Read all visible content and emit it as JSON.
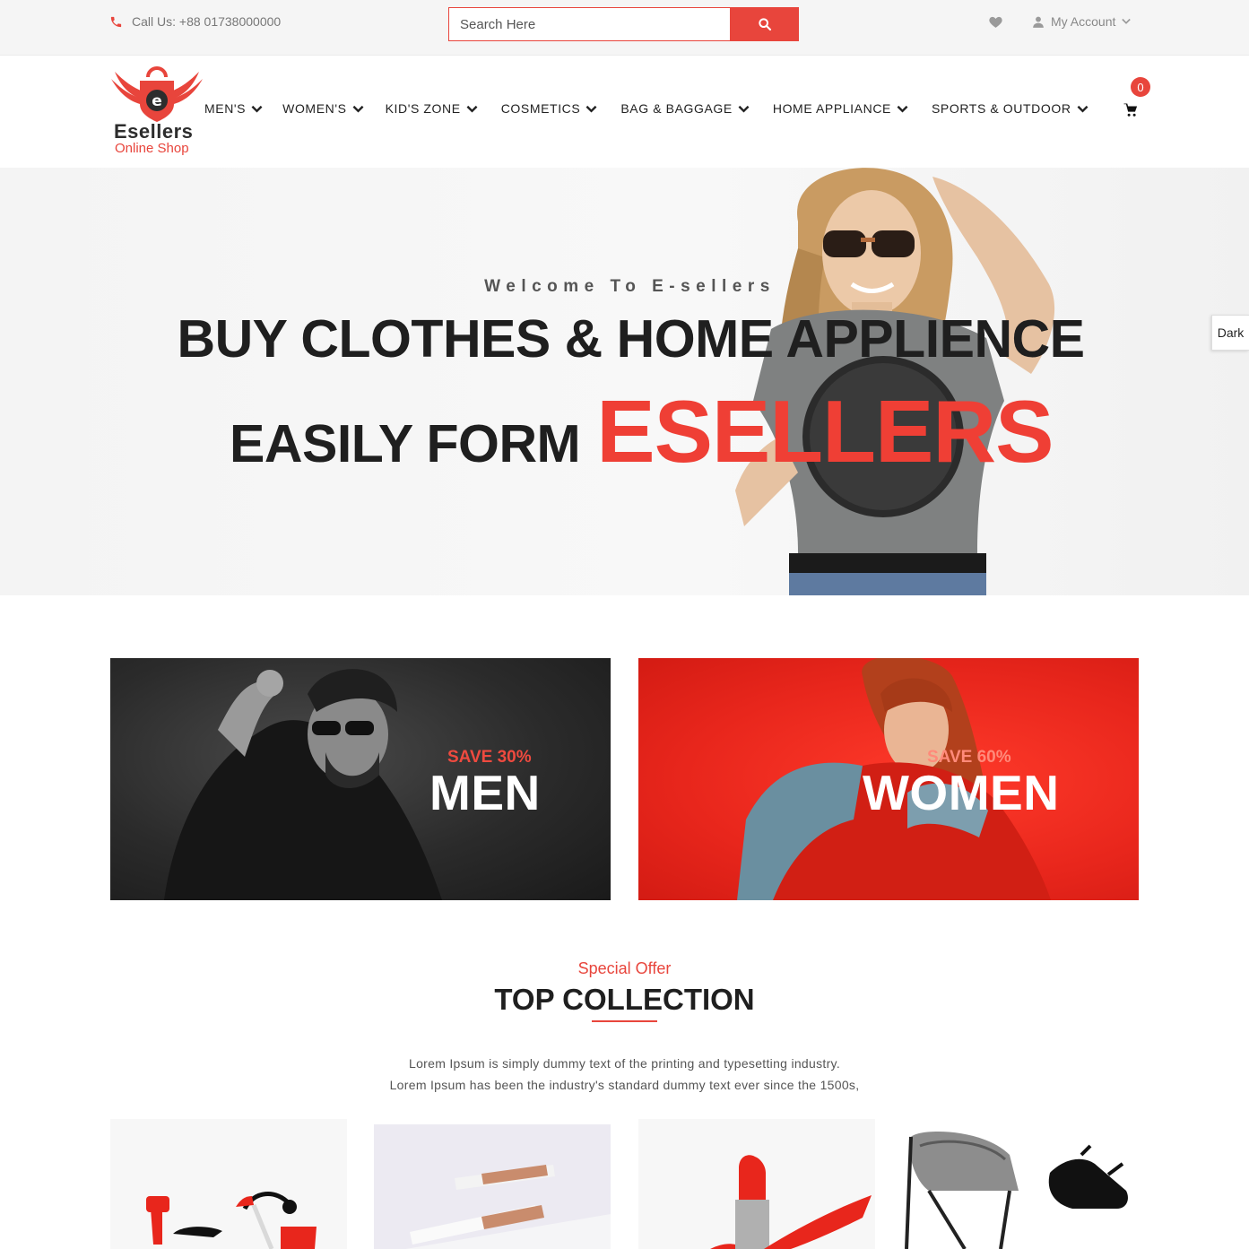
{
  "topbar": {
    "call_text": "Call Us: +88 01738000000",
    "search_placeholder": "Search Here",
    "account_label": "My Account"
  },
  "brand": {
    "name": "Esellers",
    "tagline": "Online Shop"
  },
  "nav": {
    "items": [
      {
        "label": "MEN'S"
      },
      {
        "label": "WOMEN'S"
      },
      {
        "label": "KID'S ZONE"
      },
      {
        "label": "COSMETICS"
      },
      {
        "label": "BAG & BAGGAGE"
      },
      {
        "label": "HOME APPLIANCE"
      },
      {
        "label": "SPORTS & OUTDOOR"
      }
    ],
    "cart_count": "0"
  },
  "hero": {
    "welcome": "Welcome To E-sellers",
    "line1": "BUY CLOTHES & HOME APPLIENCE",
    "line2_lead": "EASILY FORM",
    "line2_brand": "ESELLERS"
  },
  "theme_toggle": "Dark",
  "banners": {
    "men": {
      "save": "SAVE 30%",
      "title": "MEN"
    },
    "women": {
      "save": "SAVE 60%",
      "title": "WOMEN"
    }
  },
  "collection": {
    "eyebrow": "Special Offer",
    "title": "TOP COLLECTION",
    "desc_line1": "Lorem Ipsum is simply dummy text of the printing and typesetting industry.",
    "desc_line2": "Lorem Ipsum has been the industry's standard dummy text ever since the 1500s,"
  },
  "colors": {
    "accent": "#e8453c",
    "topbar_bg": "#f5f5f5",
    "text_dark": "#1f1f1f"
  },
  "icons": [
    "phone-icon",
    "search-icon",
    "heart-icon",
    "user-icon",
    "chevron-down-icon",
    "cart-icon"
  ]
}
